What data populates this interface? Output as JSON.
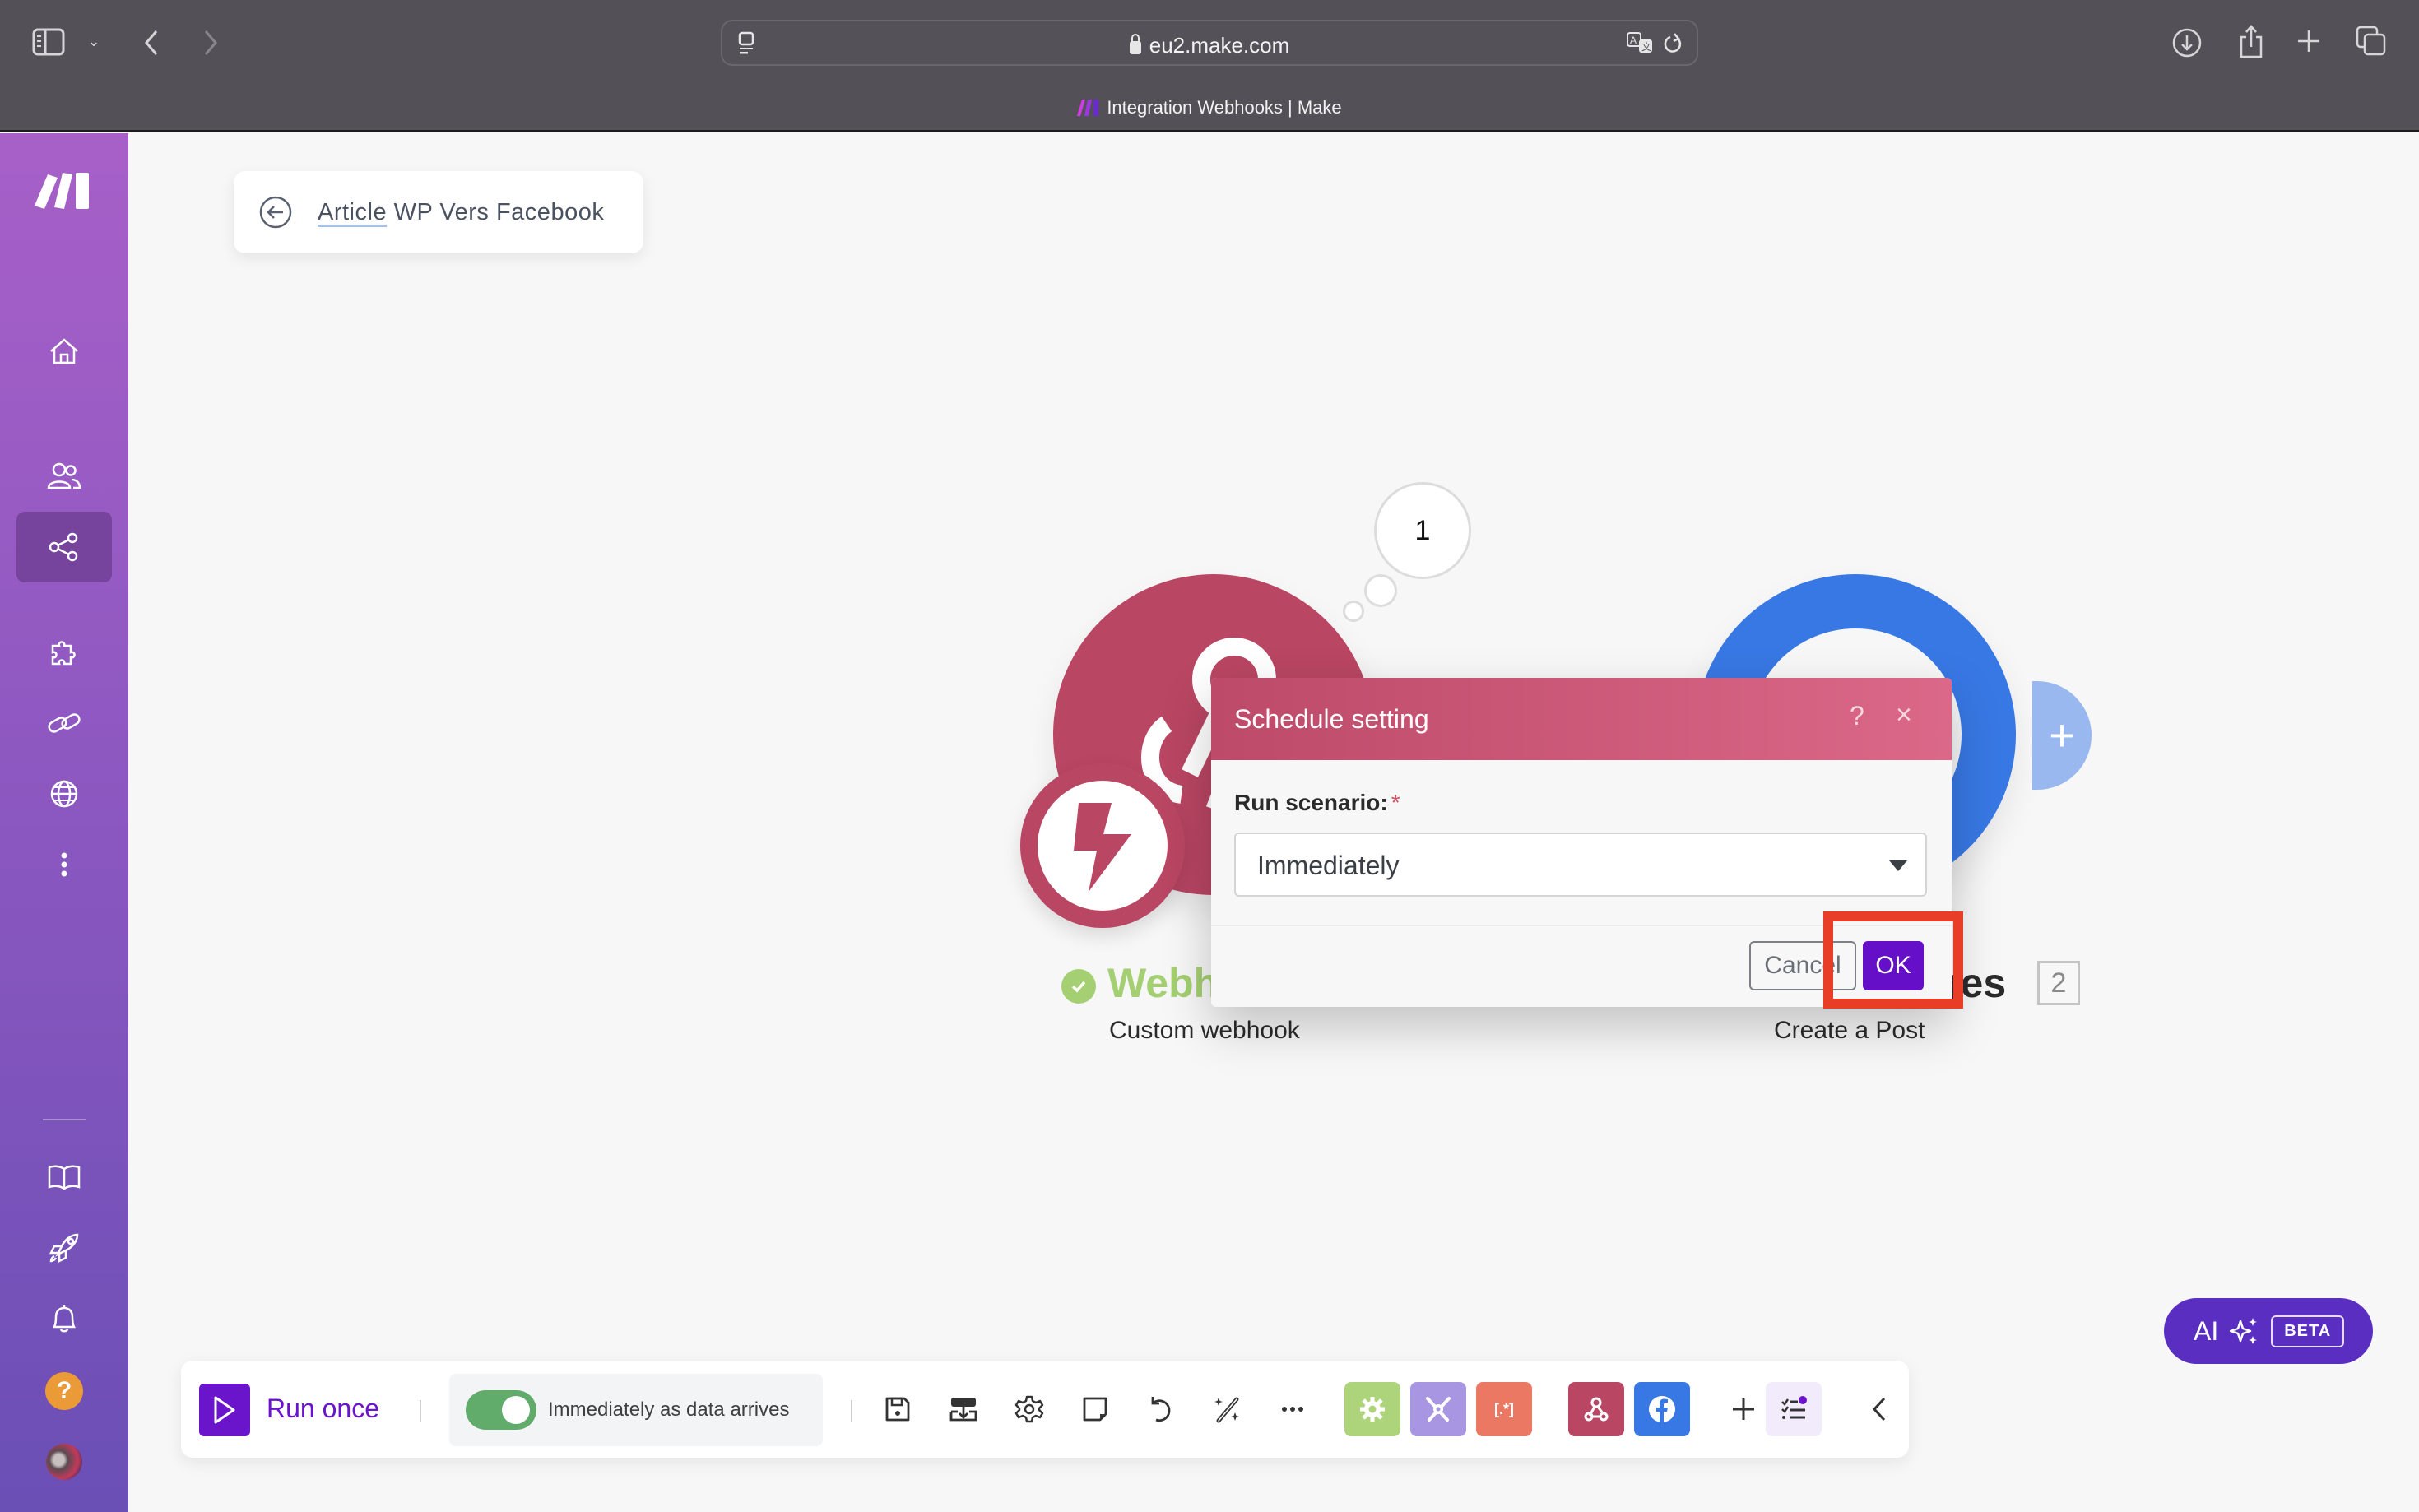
{
  "browser": {
    "url": "eu2.make.com",
    "tab_title": "Integration Webhooks | Make",
    "icons": [
      "sidebar-toggle-icon",
      "chevron-down-icon",
      "back-icon",
      "forward-icon",
      "reader-icon",
      "lock-icon",
      "translate-icon",
      "reload-icon",
      "download-icon",
      "share-icon",
      "new-tab-icon",
      "tabs-overview-icon"
    ]
  },
  "sidebar": {
    "logo": "make-logo",
    "items": [
      {
        "name": "home",
        "icon": "home-icon",
        "active": false
      },
      {
        "name": "team",
        "icon": "users-icon",
        "active": false
      },
      {
        "name": "scenarios",
        "icon": "share-nodes-icon",
        "active": true
      },
      {
        "name": "templates",
        "icon": "puzzle-icon",
        "active": false
      },
      {
        "name": "connections",
        "icon": "link-icon",
        "active": false
      },
      {
        "name": "webhooks",
        "icon": "globe-icon",
        "active": false
      },
      {
        "name": "more",
        "icon": "more-vertical-icon",
        "active": false
      }
    ],
    "bottom_items": [
      {
        "name": "docs",
        "icon": "book-icon"
      },
      {
        "name": "whats-new",
        "icon": "rocket-icon"
      },
      {
        "name": "notifications",
        "icon": "bell-icon"
      },
      {
        "name": "help",
        "icon": "help-icon",
        "label": "?"
      },
      {
        "name": "profile",
        "icon": "avatar"
      }
    ]
  },
  "breadcrumb": {
    "back_icon": "arrow-left-circle-icon",
    "title_underlined": "Article",
    "title_rest": " WP Vers Facebook"
  },
  "canvas": {
    "bubble_count": "1",
    "modules": [
      {
        "id": "webhooks",
        "title_visible": "Webh",
        "subtitle": "Custom webhook",
        "status": "ok",
        "color": "#b94663",
        "trigger": true
      },
      {
        "id": "facebook",
        "title_visible": "ges",
        "subtitle": "Create a Post",
        "number": "2",
        "color": "#3878e4"
      }
    ],
    "add_module_label": "+"
  },
  "modal": {
    "title": "Schedule setting",
    "help_label": "?",
    "close_label": "×",
    "field_label": "Run scenario:",
    "required_mark": "*",
    "select_value": "Immediately",
    "cancel_label": "Cancel",
    "ok_label": "OK"
  },
  "toolbar": {
    "run_once_label": "Run once",
    "schedule_toggle_on": true,
    "schedule_label": "Immediately as data arrives",
    "tools": [
      "save-icon",
      "import-blueprint-icon",
      "settings-icon",
      "notes-icon",
      "undo-icon",
      "auto-align-icon",
      "more-horizontal-icon"
    ],
    "apps": [
      {
        "name": "tools",
        "color": "#aed47b",
        "icon": "gear-icon"
      },
      {
        "name": "flow-control",
        "color": "#a896e2",
        "icon": "wrench-icon"
      },
      {
        "name": "text-parser",
        "color": "#ea7862",
        "icon": "regex-icon",
        "glyph": "[.*]"
      },
      {
        "name": "webhooks",
        "color": "#b94663",
        "icon": "webhook-icon"
      },
      {
        "name": "facebook-pages",
        "color": "#3878e4",
        "icon": "facebook-icon"
      }
    ],
    "add_label": "+",
    "collapse_icon": "chevron-left-icon"
  },
  "ai_button": {
    "label": "AI",
    "badge": "BETA"
  },
  "colors": {
    "brand_purple": "#6a14cc",
    "modal_header": "#bd4a69",
    "highlight": "#e83e27",
    "status_ok": "#a4cf72"
  }
}
